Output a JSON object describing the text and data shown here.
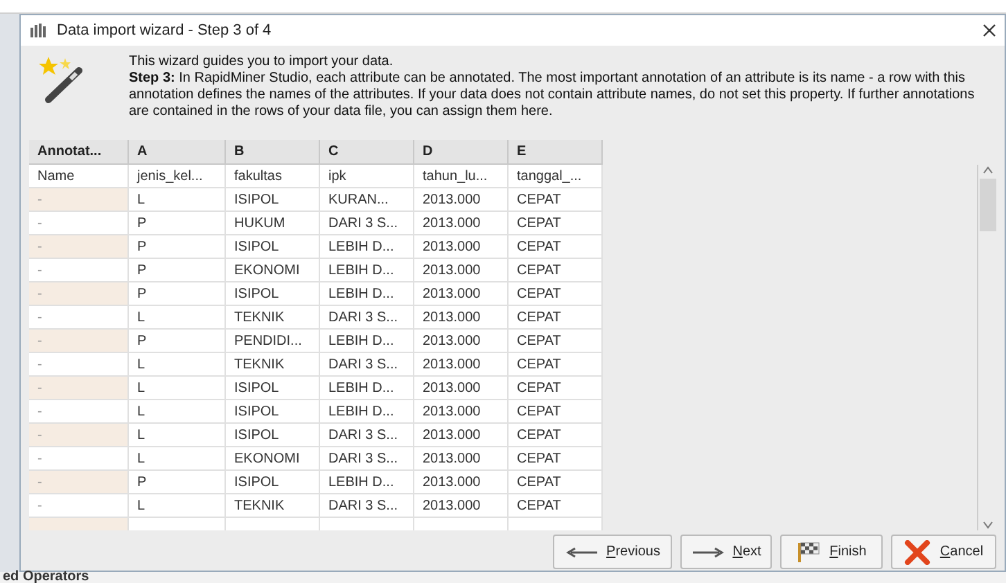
{
  "window": {
    "title": "Data import wizard - Step 3 of 4"
  },
  "intro": {
    "lead": "This wizard guides you to import your data.",
    "body": "**Step 3:** In RapidMiner Studio, each attribute can be annotated. The most important annotation of an attribute is its name - a row with this annotation defines the names of the attributes. If your data does not contain attribute names, do not set this property. If further annotations are contained in the rows of your data file, you can assign them here."
  },
  "table": {
    "columns": [
      "Annotat...",
      "A",
      "B",
      "C",
      "D",
      "E"
    ],
    "rows": [
      [
        "Name",
        "jenis_kel...",
        "fakultas",
        "ipk",
        "tahun_lu...",
        "tanggal_..."
      ],
      [
        "-",
        "L",
        "ISIPOL",
        "KURAN...",
        "2013.000",
        "CEPAT"
      ],
      [
        "-",
        "P",
        "HUKUM",
        "DARI 3 S...",
        "2013.000",
        "CEPAT"
      ],
      [
        "-",
        "P",
        "ISIPOL",
        "LEBIH D...",
        "2013.000",
        "CEPAT"
      ],
      [
        "-",
        "P",
        "EKONOMI",
        "LEBIH D...",
        "2013.000",
        "CEPAT"
      ],
      [
        "-",
        "P",
        "ISIPOL",
        "LEBIH D...",
        "2013.000",
        "CEPAT"
      ],
      [
        "-",
        "L",
        "TEKNIK",
        "DARI 3 S...",
        "2013.000",
        "CEPAT"
      ],
      [
        "-",
        "P",
        "PENDIDI...",
        "LEBIH D...",
        "2013.000",
        "CEPAT"
      ],
      [
        "-",
        "L",
        "TEKNIK",
        "DARI 3 S...",
        "2013.000",
        "CEPAT"
      ],
      [
        "-",
        "L",
        "ISIPOL",
        "LEBIH D...",
        "2013.000",
        "CEPAT"
      ],
      [
        "-",
        "L",
        "ISIPOL",
        "LEBIH D...",
        "2013.000",
        "CEPAT"
      ],
      [
        "-",
        "L",
        "ISIPOL",
        "DARI 3 S...",
        "2013.000",
        "CEPAT"
      ],
      [
        "-",
        "L",
        "EKONOMI",
        "DARI 3 S...",
        "2013.000",
        "CEPAT"
      ],
      [
        "-",
        "P",
        "ISIPOL",
        "LEBIH D...",
        "2013.000",
        "CEPAT"
      ],
      [
        "-",
        "L",
        "TEKNIK",
        "DARI 3 S...",
        "2013.000",
        "CEPAT"
      ]
    ]
  },
  "buttons": [
    {
      "label": "Previous",
      "kind": "previous"
    },
    {
      "label": "Next",
      "kind": "next"
    },
    {
      "label": "Finish",
      "kind": "finish"
    },
    {
      "label": "Cancel",
      "kind": "cancel"
    }
  ],
  "background": {
    "panel_label": "ed Operators"
  }
}
